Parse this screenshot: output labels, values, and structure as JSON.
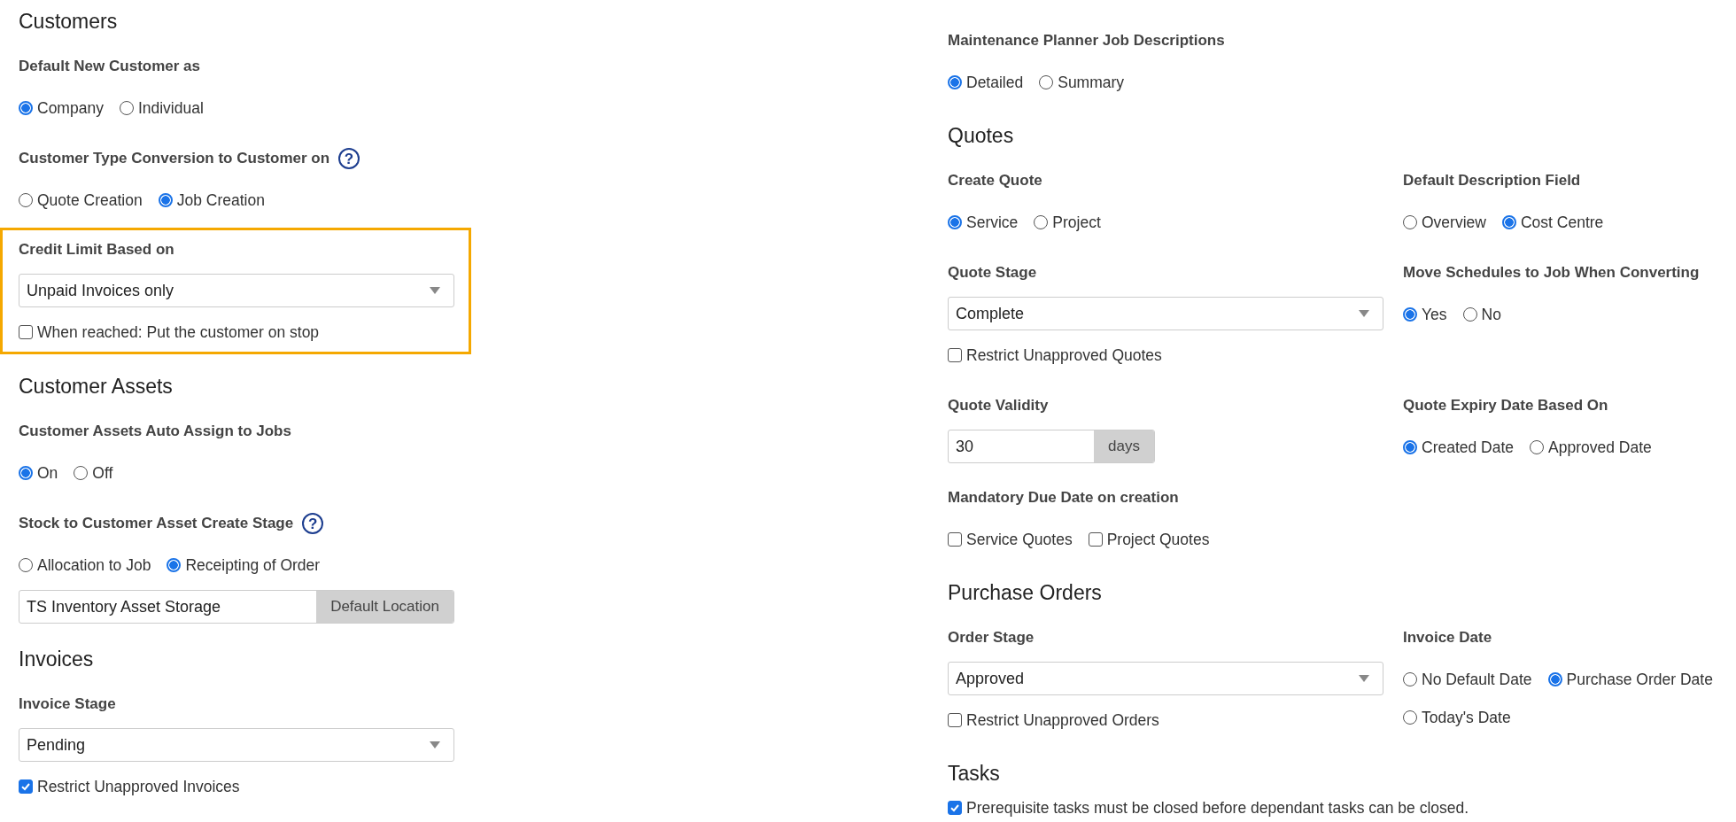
{
  "left_column": [
    {
      "kind": "heading",
      "text": "Customers"
    },
    {
      "kind": "group",
      "label": "Default New Customer as",
      "controls": [
        {
          "kind": "radios",
          "options": [
            {
              "label": "Company",
              "selected": true
            },
            {
              "label": "Individual",
              "selected": false
            }
          ]
        }
      ]
    },
    {
      "kind": "group",
      "label": "Customer Type Conversion to Customer on",
      "help": "?",
      "controls": [
        {
          "kind": "radios",
          "options": [
            {
              "label": "Quote Creation",
              "selected": false
            },
            {
              "label": "Job Creation",
              "selected": true
            }
          ]
        }
      ]
    },
    {
      "kind": "group",
      "label": "Credit Limit Based on",
      "highlighted": true,
      "controls": [
        {
          "kind": "select",
          "value": "Unpaid Invoices only"
        },
        {
          "kind": "checkboxes",
          "options": [
            {
              "label": "When reached: Put the customer on stop",
              "checked": false
            }
          ]
        }
      ]
    },
    {
      "kind": "heading",
      "text": "Customer Assets"
    },
    {
      "kind": "group",
      "label": "Customer Assets Auto Assign to Jobs",
      "controls": [
        {
          "kind": "radios",
          "options": [
            {
              "label": "On",
              "selected": true
            },
            {
              "label": "Off",
              "selected": false
            }
          ]
        }
      ]
    },
    {
      "kind": "group",
      "label": "Stock to Customer Asset Create Stage",
      "help": "?",
      "controls": [
        {
          "kind": "radios",
          "options": [
            {
              "label": "Allocation to Job",
              "selected": false
            },
            {
              "label": "Receipting of Order",
              "selected": true
            }
          ]
        },
        {
          "kind": "addon_input",
          "value": "TS Inventory Asset Storage",
          "addon": "Default Location"
        }
      ]
    },
    {
      "kind": "heading",
      "text": "Invoices"
    },
    {
      "kind": "group",
      "label": "Invoice Stage",
      "controls": [
        {
          "kind": "select",
          "value": "Pending"
        },
        {
          "kind": "checkboxes",
          "options": [
            {
              "label": "Restrict Unapproved Invoices",
              "checked": true
            }
          ]
        }
      ]
    }
  ],
  "right_column": [
    {
      "kind": "row",
      "groups": [
        {
          "label": "Maintenance Planner Job Descriptions",
          "controls": [
            {
              "kind": "radios",
              "options": [
                {
                  "label": "Detailed",
                  "selected": true
                },
                {
                  "label": "Summary",
                  "selected": false
                }
              ]
            }
          ]
        }
      ]
    },
    {
      "kind": "heading",
      "text": "Quotes"
    },
    {
      "kind": "row",
      "groups": [
        {
          "label": "Create Quote",
          "controls": [
            {
              "kind": "radios",
              "options": [
                {
                  "label": "Service",
                  "selected": true
                },
                {
                  "label": "Project",
                  "selected": false
                }
              ]
            }
          ]
        },
        {
          "label": "Default Description Field",
          "controls": [
            {
              "kind": "radios",
              "options": [
                {
                  "label": "Overview",
                  "selected": false
                },
                {
                  "label": "Cost Centre",
                  "selected": true
                }
              ]
            }
          ]
        }
      ]
    },
    {
      "kind": "row",
      "groups": [
        {
          "label": "Quote Stage",
          "controls": [
            {
              "kind": "select",
              "value": "Complete"
            },
            {
              "kind": "checkboxes",
              "options": [
                {
                  "label": "Restrict Unapproved Quotes",
                  "checked": false
                }
              ]
            }
          ]
        },
        {
          "label": "Move Schedules to Job When Converting",
          "controls": [
            {
              "kind": "radios",
              "options": [
                {
                  "label": "Yes",
                  "selected": true
                },
                {
                  "label": "No",
                  "selected": false
                }
              ]
            }
          ]
        }
      ]
    },
    {
      "kind": "row",
      "groups": [
        {
          "label": "Quote Validity",
          "controls": [
            {
              "kind": "addon_input",
              "value": "30",
              "addon": "days"
            }
          ]
        },
        {
          "label": "Quote Expiry Date Based On",
          "controls": [
            {
              "kind": "radios",
              "options": [
                {
                  "label": "Created Date",
                  "selected": true
                },
                {
                  "label": "Approved Date",
                  "selected": false
                }
              ]
            }
          ]
        }
      ]
    },
    {
      "kind": "row",
      "groups": [
        {
          "label": "Mandatory Due Date on creation",
          "controls": [
            {
              "kind": "checkboxes",
              "options": [
                {
                  "label": "Service Quotes",
                  "checked": false
                },
                {
                  "label": "Project Quotes",
                  "checked": false
                }
              ]
            }
          ]
        }
      ]
    },
    {
      "kind": "heading",
      "text": "Purchase Orders"
    },
    {
      "kind": "row",
      "groups": [
        {
          "label": "Order Stage",
          "controls": [
            {
              "kind": "select",
              "value": "Approved"
            },
            {
              "kind": "checkboxes",
              "options": [
                {
                  "label": "Restrict Unapproved Orders",
                  "checked": false
                }
              ]
            }
          ]
        },
        {
          "label": "Invoice Date",
          "controls": [
            {
              "kind": "radios",
              "options": [
                {
                  "label": "No Default Date",
                  "selected": false
                },
                {
                  "label": "Purchase Order Date",
                  "selected": true
                },
                {
                  "label": "Today's Date",
                  "selected": false
                }
              ]
            }
          ]
        }
      ]
    },
    {
      "kind": "heading",
      "text": "Tasks"
    },
    {
      "kind": "row",
      "groups": [
        {
          "controls": [
            {
              "kind": "checkboxes",
              "options": [
                {
                  "label": "Prerequisite tasks must be closed before dependant tasks can be closed.",
                  "checked": true
                }
              ]
            }
          ]
        }
      ]
    }
  ]
}
